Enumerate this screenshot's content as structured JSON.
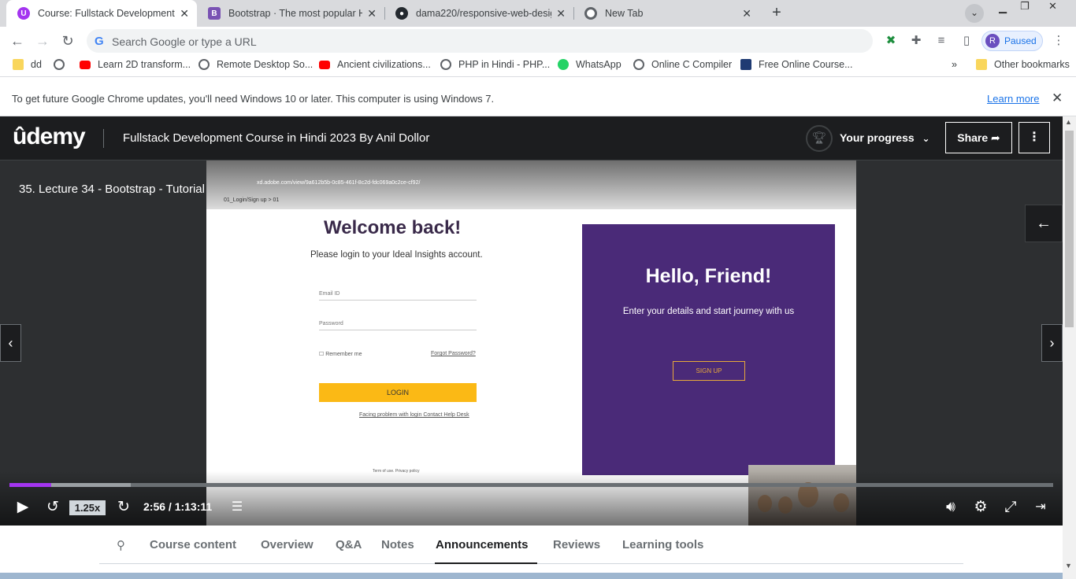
{
  "browser": {
    "tabs": [
      {
        "title": "Course: Fullstack Development C",
        "favicon": "udemy-icon",
        "color": "#a435f0"
      },
      {
        "title": "Bootstrap · The most popular HT",
        "favicon": "bootstrap-icon",
        "color": "#7952b3"
      },
      {
        "title": "dama220/responsive-web-desig",
        "favicon": "github-icon",
        "color": "#24292f"
      },
      {
        "title": "New Tab",
        "favicon": "chrome-icon",
        "color": "#5f6368"
      }
    ],
    "omnibox_placeholder": "Search Google or type a URL",
    "profile_initial": "R",
    "profile_status": "Paused",
    "bookmarks": [
      {
        "label": "dd",
        "icon": "folder-icon"
      },
      {
        "label": "Learn 2D transform...",
        "icon": "youtube-icon"
      },
      {
        "label": "Remote Desktop So...",
        "icon": "globe-icon"
      },
      {
        "label": "Ancient civilizations...",
        "icon": "youtube-icon"
      },
      {
        "label": "PHP in Hindi - PHP...",
        "icon": "globe-icon"
      },
      {
        "label": "WhatsApp",
        "icon": "whatsapp-icon"
      },
      {
        "label": "Online C Compiler",
        "icon": "globe-icon"
      },
      {
        "label": "Free Online Course...",
        "icon": "translate-icon"
      }
    ],
    "other_bookmarks": "Other bookmarks",
    "more_bookmarks": "»",
    "infobar": {
      "message": "To get future Google Chrome updates, you'll need Windows 10 or later. This computer is using Windows 7.",
      "link": "Learn more",
      "close": "✕"
    }
  },
  "udemy": {
    "logo": "ûdemy",
    "course_title": "Fullstack Development Course in Hindi 2023 By Anil Dollor",
    "progress_label": "Your progress",
    "share_label": "Share ➦",
    "more_label": "⋮"
  },
  "player": {
    "lecture_title": "35. Lecture 34 - Bootstrap - Tutorial",
    "speed": "1.25x",
    "time": "2:56 / 1:13:11",
    "played_fraction": 0.04,
    "buffered_fraction": 0.116,
    "video": {
      "url": "xd.adobe.com/view/9a612b5b-0c85-461f-8c2d-fdc069a0c2ce-cf92/",
      "breadcrumb": "01_Login/Sign up  >  01",
      "heading": "Welcome back!",
      "subtitle": "Please login to your Ideal Insights account.",
      "email_placeholder": "Email ID",
      "password_placeholder": "Password",
      "remember": "Remember me",
      "forgot": "Forgot Password?",
      "login_button": "LOGIN",
      "help_link": "Facing problem with login Contact Help Desk",
      "terms": "Term of use. Privacy policy",
      "panel_heading": "Hello, Friend!",
      "panel_text": "Enter your details and start journey with us",
      "signup_button": "SIGN UP"
    }
  },
  "course_tabs": [
    "Course content",
    "Overview",
    "Q&A",
    "Notes",
    "Announcements",
    "Reviews",
    "Learning tools"
  ],
  "active_tab": "Announcements"
}
